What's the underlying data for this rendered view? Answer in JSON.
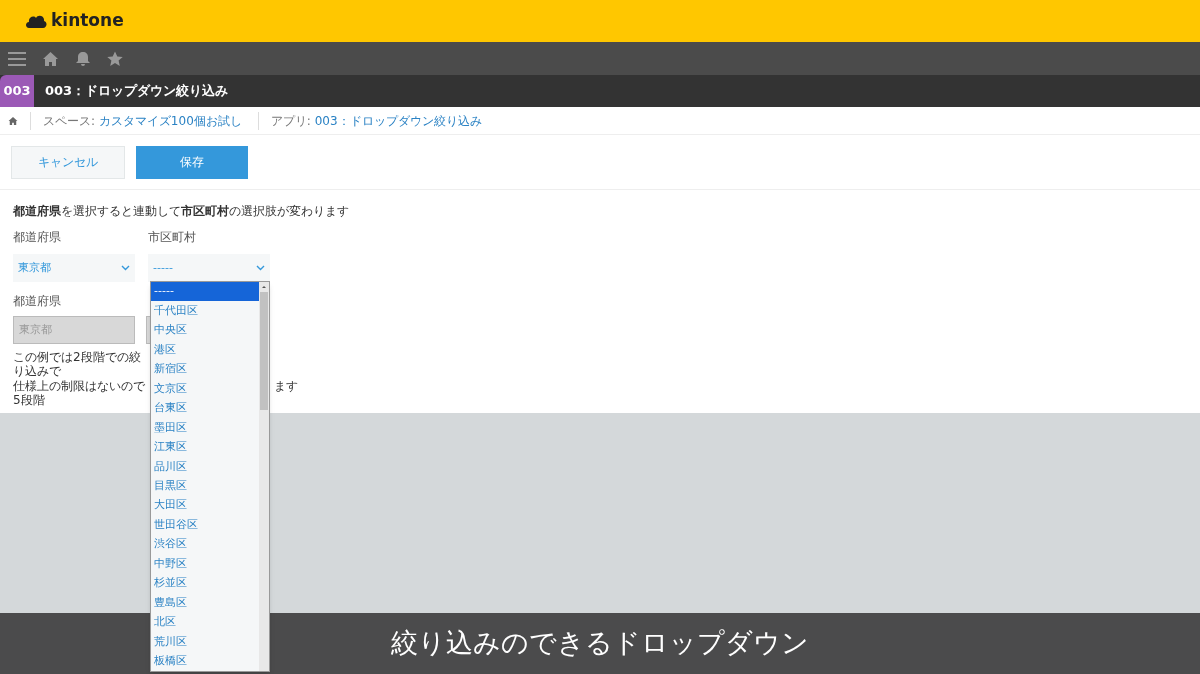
{
  "header": {
    "logo": "kintone"
  },
  "app_bar": {
    "badge": "003",
    "title": "003：ドロップダウン絞り込み"
  },
  "breadcrumb": [
    {
      "prefix": "スペース: ",
      "link": "カスタマイズ100個お試し"
    },
    {
      "prefix": "アプリ: ",
      "link": "003：ドロップダウン絞り込み"
    }
  ],
  "buttons": {
    "cancel": "キャンセル",
    "save": "保存"
  },
  "description": "**都道府県**を選択すると連動して**市区町村**の選択肢が変わります",
  "row1": [
    {
      "label": "都道府県",
      "value": "東京都"
    },
    {
      "label": "市区町村",
      "value": "-----"
    }
  ],
  "row2": {
    "label": "都道府県",
    "value": "東京都",
    "disabled": true
  },
  "notes": [
    {
      "text": "この例では2段階での絞り込みで"
    },
    {
      "text": "仕様上の制限はないので 5段階",
      "tail": "ます"
    }
  ],
  "dropdown_options": [
    {
      "label": "-----",
      "selected": true
    },
    {
      "label": "千代田区",
      "selected": false
    },
    {
      "label": "中央区",
      "selected": false
    },
    {
      "label": "港区",
      "selected": false
    },
    {
      "label": "新宿区",
      "selected": false
    },
    {
      "label": "文京区",
      "selected": false
    },
    {
      "label": "台東区",
      "selected": false
    },
    {
      "label": "墨田区",
      "selected": false
    },
    {
      "label": "江東区",
      "selected": false
    },
    {
      "label": "品川区",
      "selected": false
    },
    {
      "label": "目黒区",
      "selected": false
    },
    {
      "label": "大田区",
      "selected": false
    },
    {
      "label": "世田谷区",
      "selected": false
    },
    {
      "label": "渋谷区",
      "selected": false
    },
    {
      "label": "中野区",
      "selected": false
    },
    {
      "label": "杉並区",
      "selected": false
    },
    {
      "label": "豊島区",
      "selected": false
    },
    {
      "label": "北区",
      "selected": false
    },
    {
      "label": "荒川区",
      "selected": false
    },
    {
      "label": "板橋区",
      "selected": false
    }
  ],
  "caption": "絞り込みのできるドロップダウン"
}
